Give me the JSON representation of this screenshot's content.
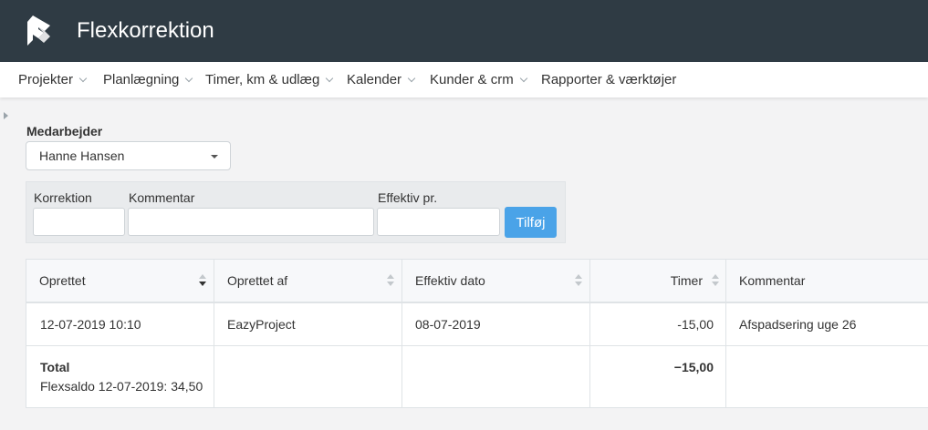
{
  "app": {
    "title": "Flexkorrektion",
    "logo_icon": "eazyproject-logo-icon"
  },
  "colors": {
    "topbar": "#2f3b44",
    "accent": "#4aa3e8",
    "page_bg": "#f3f3f4"
  },
  "nav": {
    "items": [
      {
        "label": "Projekter",
        "has_dropdown": true
      },
      {
        "label": "Planlægning",
        "has_dropdown": true
      },
      {
        "label": "Timer, km & udlæg",
        "has_dropdown": true
      },
      {
        "label": "Kalender",
        "has_dropdown": true
      },
      {
        "label": "Kunder & crm",
        "has_dropdown": true
      },
      {
        "label": "Rapporter & værktøjer",
        "has_dropdown": false
      }
    ]
  },
  "employee": {
    "label": "Medarbejder",
    "selected": "Hanne Hansen"
  },
  "form": {
    "correction_label": "Korrektion",
    "comment_label": "Kommentar",
    "effective_label": "Effektiv pr.",
    "add_button": "Tilføj"
  },
  "table": {
    "headers": [
      "Oprettet",
      "Oprettet af",
      "Effektiv dato",
      "Timer",
      "Kommentar"
    ],
    "sorted_column": "Oprettet",
    "rows": [
      {
        "created": "12-07-2019 10:10",
        "created_by": "EazyProject",
        "effective_date": "08-07-2019",
        "hours": "-15,00",
        "comment": "Afspadsering uge 26"
      }
    ],
    "total": {
      "label": "Total",
      "balance": "Flexsaldo 12-07-2019: 34,50",
      "hours": "−15,00"
    }
  }
}
